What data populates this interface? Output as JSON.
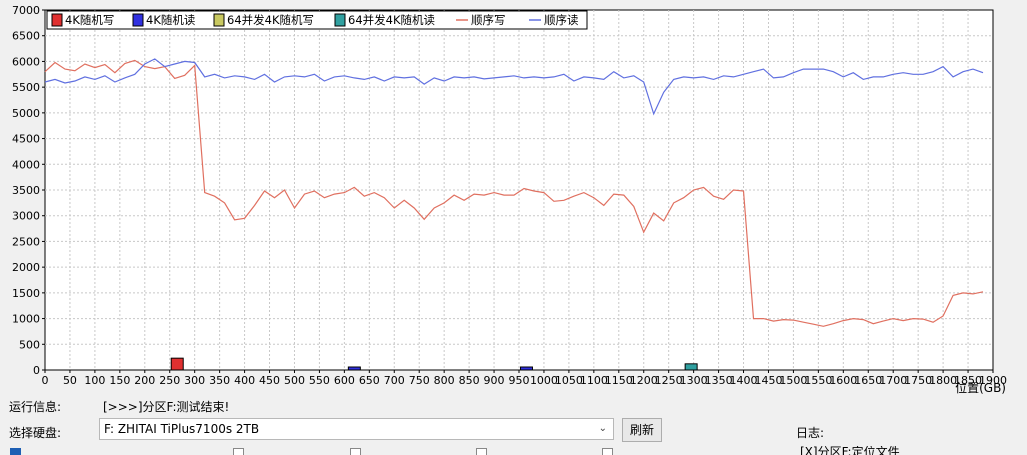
{
  "chart_data": {
    "type": "line",
    "xlabel": "位置(GB)",
    "ylabel": "",
    "xlim": [
      0,
      1900
    ],
    "ylim": [
      0,
      7000
    ],
    "x_ticks": [
      0,
      50,
      100,
      150,
      200,
      250,
      300,
      350,
      400,
      450,
      500,
      550,
      600,
      650,
      700,
      750,
      800,
      850,
      900,
      950,
      1000,
      1050,
      1100,
      1150,
      1200,
      1250,
      1300,
      1350,
      1400,
      1450,
      1500,
      1550,
      1600,
      1650,
      1700,
      1750,
      1800,
      1850,
      1900
    ],
    "y_ticks": [
      0,
      500,
      1000,
      1500,
      2000,
      2500,
      3000,
      3500,
      4000,
      4500,
      5000,
      5500,
      6000,
      6500,
      7000
    ],
    "grid": true,
    "legend_placement": "top-left",
    "legend": [
      {
        "label": "4K随机写",
        "kind": "box",
        "color": "#e03030"
      },
      {
        "label": "4K随机读",
        "kind": "box",
        "color": "#3030e0"
      },
      {
        "label": "64并发4K随机写",
        "kind": "box",
        "color": "#c8c860"
      },
      {
        "label": "64并发4K随机读",
        "kind": "box",
        "color": "#30a0a0"
      },
      {
        "label": "顺序写",
        "kind": "line",
        "color": "#e07060"
      },
      {
        "label": "顺序读",
        "kind": "line",
        "color": "#6070e0"
      }
    ],
    "series": [
      {
        "name": "顺序写",
        "color": "#e07060",
        "x": [
          0,
          20,
          40,
          60,
          80,
          100,
          120,
          140,
          160,
          180,
          200,
          220,
          240,
          260,
          280,
          300,
          320,
          340,
          360,
          380,
          400,
          420,
          440,
          460,
          480,
          500,
          520,
          540,
          560,
          580,
          600,
          620,
          640,
          660,
          680,
          700,
          720,
          740,
          760,
          780,
          800,
          820,
          840,
          860,
          880,
          900,
          920,
          940,
          960,
          980,
          1000,
          1020,
          1040,
          1060,
          1080,
          1100,
          1120,
          1140,
          1160,
          1180,
          1200,
          1220,
          1240,
          1260,
          1280,
          1300,
          1320,
          1340,
          1360,
          1380,
          1400,
          1420,
          1440,
          1460,
          1480,
          1500,
          1520,
          1540,
          1560,
          1580,
          1600,
          1620,
          1640,
          1660,
          1680,
          1700,
          1720,
          1740,
          1760,
          1780,
          1800,
          1820,
          1840,
          1860,
          1880
        ],
        "values": [
          5800,
          5980,
          5850,
          5820,
          5950,
          5880,
          5940,
          5780,
          5960,
          6020,
          5900,
          5860,
          5900,
          5670,
          5730,
          5920,
          3450,
          3380,
          3250,
          2920,
          2950,
          3200,
          3480,
          3350,
          3500,
          3150,
          3420,
          3480,
          3350,
          3420,
          3450,
          3550,
          3380,
          3450,
          3350,
          3150,
          3300,
          3150,
          2930,
          3150,
          3250,
          3400,
          3300,
          3420,
          3400,
          3450,
          3400,
          3400,
          3530,
          3480,
          3450,
          3280,
          3300,
          3380,
          3450,
          3350,
          3200,
          3420,
          3400,
          3180,
          2680,
          3050,
          2900,
          3250,
          3350,
          3500,
          3550,
          3380,
          3320,
          3500,
          3480,
          1000,
          1000,
          950,
          980,
          970,
          930,
          890,
          850,
          900,
          960,
          1000,
          980,
          900,
          950,
          1000,
          960,
          1000,
          990,
          930,
          1050,
          1450,
          1500,
          1480,
          1520
        ]
      },
      {
        "name": "顺序读",
        "color": "#6070e0",
        "x": [
          0,
          20,
          40,
          60,
          80,
          100,
          120,
          140,
          160,
          180,
          200,
          220,
          240,
          260,
          280,
          300,
          320,
          340,
          360,
          380,
          400,
          420,
          440,
          460,
          480,
          500,
          520,
          540,
          560,
          580,
          600,
          620,
          640,
          660,
          680,
          700,
          720,
          740,
          760,
          780,
          800,
          820,
          840,
          860,
          880,
          900,
          920,
          940,
          960,
          980,
          1000,
          1020,
          1040,
          1060,
          1080,
          1100,
          1120,
          1140,
          1160,
          1180,
          1200,
          1220,
          1240,
          1260,
          1280,
          1300,
          1320,
          1340,
          1360,
          1380,
          1400,
          1420,
          1440,
          1460,
          1480,
          1500,
          1520,
          1540,
          1560,
          1580,
          1600,
          1620,
          1640,
          1660,
          1680,
          1700,
          1720,
          1740,
          1760,
          1780,
          1800,
          1820,
          1840,
          1860,
          1880
        ],
        "values": [
          5600,
          5650,
          5580,
          5620,
          5700,
          5650,
          5720,
          5600,
          5680,
          5750,
          5950,
          6050,
          5900,
          5950,
          6000,
          5980,
          5700,
          5750,
          5680,
          5720,
          5700,
          5650,
          5750,
          5600,
          5700,
          5720,
          5700,
          5750,
          5620,
          5700,
          5720,
          5680,
          5650,
          5700,
          5620,
          5700,
          5680,
          5700,
          5560,
          5680,
          5620,
          5700,
          5680,
          5700,
          5660,
          5680,
          5700,
          5720,
          5680,
          5700,
          5680,
          5700,
          5750,
          5620,
          5700,
          5680,
          5650,
          5800,
          5680,
          5720,
          5600,
          4980,
          5400,
          5650,
          5700,
          5680,
          5700,
          5650,
          5720,
          5700,
          5750,
          5800,
          5850,
          5680,
          5700,
          5780,
          5850,
          5850,
          5850,
          5800,
          5700,
          5780,
          5650,
          5700,
          5700,
          5750,
          5780,
          5750,
          5750,
          5800,
          5900,
          5700,
          5800,
          5850,
          5780
        ]
      }
    ],
    "markers": [
      {
        "series": "4K随机写",
        "x": 265,
        "value": 230,
        "color": "#e03030"
      },
      {
        "series": "4K随机读",
        "x": 620,
        "value": 20,
        "color": "#3030e0"
      },
      {
        "series": "4K随机读",
        "x": 965,
        "value": 10,
        "color": "#3030e0"
      },
      {
        "series": "64并发4K随机读",
        "x": 1295,
        "value": 120,
        "color": "#30a0a0"
      }
    ]
  },
  "status": {
    "label": "运行信息:",
    "text": "[>>>]分区F:测试结束!"
  },
  "drive": {
    "label": "选择硬盘:",
    "value": "F: ZHITAI TiPlus7100s 2TB",
    "chevron": "⌄"
  },
  "refresh_label": "刷新",
  "log": {
    "label": "日志:",
    "partial": "[X]分区F:定位文件"
  }
}
